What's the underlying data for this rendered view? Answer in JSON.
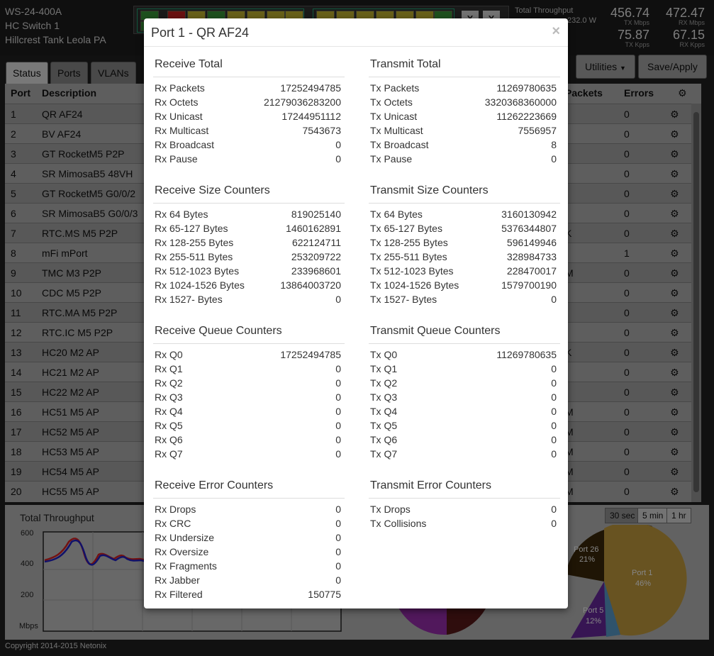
{
  "device": {
    "model": "WS-24-400A",
    "name": "HC Switch 1",
    "location": "Hillcrest Tank Leola PA"
  },
  "header": {
    "throughput_label": "Total Throughput",
    "power": "232.0 W",
    "tx_mbps": "456.74",
    "tx_mbps_label": "TX Mbps",
    "rx_mbps": "472.47",
    "rx_mbps_label": "RX Mbps",
    "tx_kpps": "75.87",
    "tx_kpps_label": "TX Kpps",
    "rx_kpps": "67.15",
    "rx_kpps_label": "RX Kpps",
    "sfp_labels": [
      "X",
      "X"
    ]
  },
  "tabs": [
    "Status",
    "Ports",
    "VLANs"
  ],
  "toolbar": {
    "utilities": "Utilities",
    "save_apply": "Save/Apply"
  },
  "table": {
    "headers": {
      "port": "Port",
      "description": "Description",
      "packets": "Packets",
      "errors": "Errors"
    },
    "rows": [
      {
        "port": "1",
        "description": "QR AF24",
        "extra": "",
        "errors": "0"
      },
      {
        "port": "2",
        "description": "BV AF24",
        "extra": "",
        "errors": "0"
      },
      {
        "port": "3",
        "description": "GT RocketM5 P2P",
        "extra": "",
        "errors": "0"
      },
      {
        "port": "4",
        "description": "SR MimosaB5 48VH",
        "extra": "",
        "errors": "0"
      },
      {
        "port": "5",
        "description": "GT RocketM5 G0/0/2",
        "extra": "",
        "errors": "0"
      },
      {
        "port": "6",
        "description": "SR MimosaB5 G0/0/3",
        "extra": "",
        "errors": "0"
      },
      {
        "port": "7",
        "description": "RTC.MS M5 P2P",
        "extra": "K",
        "errors": "0"
      },
      {
        "port": "8",
        "description": "mFi mPort",
        "extra": "",
        "errors": "1"
      },
      {
        "port": "9",
        "description": "TMC M3 P2P",
        "extra": "M",
        "errors": "0"
      },
      {
        "port": "10",
        "description": "CDC M5 P2P",
        "extra": "",
        "errors": "0"
      },
      {
        "port": "11",
        "description": "RTC.MA M5 P2P",
        "extra": "",
        "errors": "0"
      },
      {
        "port": "12",
        "description": "RTC.IC M5 P2P",
        "extra": "",
        "errors": "0"
      },
      {
        "port": "13",
        "description": "HC20 M2 AP",
        "extra": "K",
        "errors": "0"
      },
      {
        "port": "14",
        "description": "HC21 M2 AP",
        "extra": "",
        "errors": "0"
      },
      {
        "port": "15",
        "description": "HC22 M2 AP",
        "extra": "",
        "errors": "0"
      },
      {
        "port": "16",
        "description": "HC51 M5 AP",
        "extra": "M",
        "errors": "0"
      },
      {
        "port": "17",
        "description": "HC52 M5 AP",
        "extra": "M",
        "errors": "0"
      },
      {
        "port": "18",
        "description": "HC53 M5 AP",
        "extra": "M",
        "errors": "0"
      },
      {
        "port": "19",
        "description": "HC54 M5 AP",
        "extra": "M",
        "errors": "0"
      },
      {
        "port": "20",
        "description": "HC55 M5 AP",
        "extra": "M",
        "errors": "0"
      }
    ]
  },
  "bottom": {
    "chart_title": "Total Throughput",
    "y_ticks": [
      "600",
      "400",
      "200"
    ],
    "y_unit": "Mbps",
    "range_buttons": [
      "30 sec",
      "5 min",
      "1 hr"
    ],
    "pie_labels": [
      {
        "name": "Port 26",
        "pct": "21%"
      },
      {
        "name": "Port 1",
        "pct": "46%"
      },
      {
        "name": "Port 5",
        "pct": "12%"
      }
    ],
    "copyright": "Copyright 2014-2015 Netonix"
  },
  "modal": {
    "title": "Port 1 - QR AF24",
    "close": "×",
    "left": [
      {
        "title": "Receive Total",
        "items": [
          {
            "k": "Rx Packets",
            "v": "17252494785"
          },
          {
            "k": "Rx Octets",
            "v": "21279036283200"
          },
          {
            "k": "Rx Unicast",
            "v": "17244951112"
          },
          {
            "k": "Rx Multicast",
            "v": "7543673"
          },
          {
            "k": "Rx Broadcast",
            "v": "0"
          },
          {
            "k": "Rx Pause",
            "v": "0"
          }
        ]
      },
      {
        "title": "Receive Size Counters",
        "items": [
          {
            "k": "Rx 64 Bytes",
            "v": "819025140"
          },
          {
            "k": "Rx 65-127 Bytes",
            "v": "1460162891"
          },
          {
            "k": "Rx 128-255 Bytes",
            "v": "622124711"
          },
          {
            "k": "Rx 255-511 Bytes",
            "v": "253209722"
          },
          {
            "k": "Rx 512-1023 Bytes",
            "v": "233968601"
          },
          {
            "k": "Rx 1024-1526 Bytes",
            "v": "13864003720"
          },
          {
            "k": "Rx 1527- Bytes",
            "v": "0"
          }
        ]
      },
      {
        "title": "Receive Queue Counters",
        "items": [
          {
            "k": "Rx Q0",
            "v": "17252494785"
          },
          {
            "k": "Rx Q1",
            "v": "0"
          },
          {
            "k": "Rx Q2",
            "v": "0"
          },
          {
            "k": "Rx Q3",
            "v": "0"
          },
          {
            "k": "Rx Q4",
            "v": "0"
          },
          {
            "k": "Rx Q5",
            "v": "0"
          },
          {
            "k": "Rx Q6",
            "v": "0"
          },
          {
            "k": "Rx Q7",
            "v": "0"
          }
        ]
      },
      {
        "title": "Receive Error Counters",
        "items": [
          {
            "k": "Rx Drops",
            "v": "0"
          },
          {
            "k": "Rx CRC",
            "v": "0"
          },
          {
            "k": "Rx Undersize",
            "v": "0"
          },
          {
            "k": "Rx Oversize",
            "v": "0"
          },
          {
            "k": "Rx Fragments",
            "v": "0"
          },
          {
            "k": "Rx Jabber",
            "v": "0"
          },
          {
            "k": "Rx Filtered",
            "v": "150775"
          }
        ]
      }
    ],
    "right": [
      {
        "title": "Transmit Total",
        "items": [
          {
            "k": "Tx Packets",
            "v": "11269780635"
          },
          {
            "k": "Tx Octets",
            "v": "3320368360000"
          },
          {
            "k": "Tx Unicast",
            "v": "11262223669"
          },
          {
            "k": "Tx Multicast",
            "v": "7556957"
          },
          {
            "k": "Tx Broadcast",
            "v": "8"
          },
          {
            "k": "Tx Pause",
            "v": "0"
          }
        ]
      },
      {
        "title": "Transmit Size Counters",
        "items": [
          {
            "k": "Tx 64 Bytes",
            "v": "3160130942"
          },
          {
            "k": "Tx 65-127 Bytes",
            "v": "5376344807"
          },
          {
            "k": "Tx 128-255 Bytes",
            "v": "596149946"
          },
          {
            "k": "Tx 255-511 Bytes",
            "v": "328984733"
          },
          {
            "k": "Tx 512-1023 Bytes",
            "v": "228470017"
          },
          {
            "k": "Tx 1024-1526 Bytes",
            "v": "1579700190"
          },
          {
            "k": "Tx 1527- Bytes",
            "v": "0"
          }
        ]
      },
      {
        "title": "Transmit Queue Counters",
        "items": [
          {
            "k": "Tx Q0",
            "v": "11269780635"
          },
          {
            "k": "Tx Q1",
            "v": "0"
          },
          {
            "k": "Tx Q2",
            "v": "0"
          },
          {
            "k": "Tx Q3",
            "v": "0"
          },
          {
            "k": "Tx Q4",
            "v": "0"
          },
          {
            "k": "Tx Q5",
            "v": "0"
          },
          {
            "k": "Tx Q6",
            "v": "0"
          },
          {
            "k": "Tx Q7",
            "v": "0"
          }
        ]
      },
      {
        "title": "Transmit Error Counters",
        "items": [
          {
            "k": "Tx Drops",
            "v": "0"
          },
          {
            "k": "Tx Collisions",
            "v": "0"
          }
        ]
      }
    ]
  }
}
